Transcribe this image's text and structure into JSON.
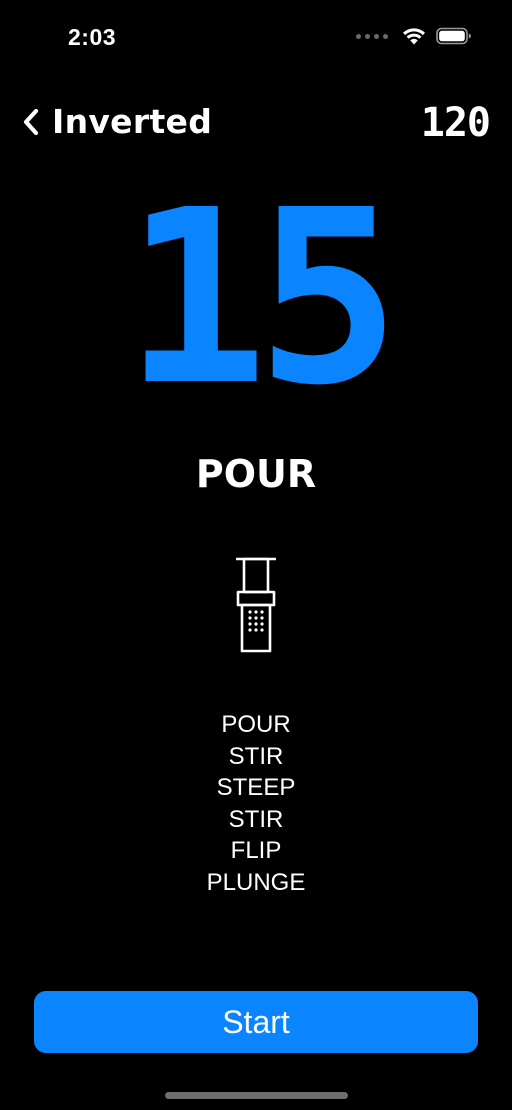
{
  "status_bar": {
    "time": "2:03",
    "icons": [
      "signal-dots-icon",
      "wifi-icon",
      "battery-icon"
    ]
  },
  "nav": {
    "back_icon": "chevron-left-icon",
    "title": "Inverted",
    "total_time": "120"
  },
  "timer": {
    "value": "15",
    "color": "#0a84ff"
  },
  "current_step": {
    "label": "POUR",
    "icon": "aeropress-icon"
  },
  "steps": [
    "POUR",
    "STIR",
    "STEEP",
    "STIR",
    "FLIP",
    "PLUNGE"
  ],
  "start_button": {
    "label": "Start",
    "color": "#0a84ff"
  }
}
